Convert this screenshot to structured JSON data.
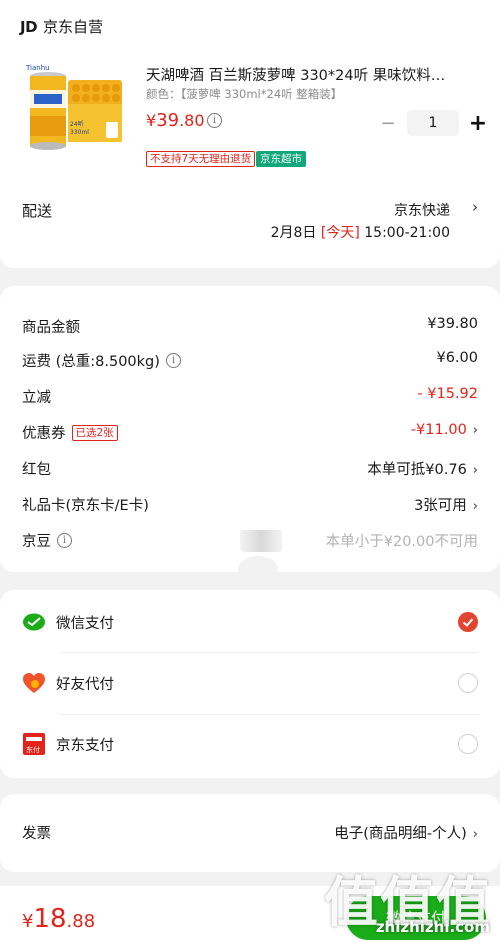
{
  "store": {
    "logo": "JD",
    "name": "京东自营"
  },
  "product": {
    "title": "天湖啤酒 百兰斯菠萝啤 330*24听 果味饮料…",
    "spec": "颜色：【菠萝啤 330ml*24听 整箱装】",
    "price_symbol": "¥",
    "price_int": "39",
    "price_dec": ".80",
    "quantity": "1",
    "tag_return": "不支持7天无理由退货",
    "tag_supermarket": "京东超市",
    "image_can_text": "24听 330ml"
  },
  "shipping": {
    "label": "配送",
    "method": "京东快递",
    "date": "2月8日",
    "today": "[今天]",
    "time": "15:00-21:00"
  },
  "summary": {
    "goods_label": "商品金额",
    "goods_value": "¥39.80",
    "freight_label": "运费 (总重:8.500kg)",
    "freight_value": "¥6.00",
    "discount_label": "立减",
    "discount_value": "- ¥15.92",
    "coupon_label": "优惠券",
    "coupon_tag": "已选2张",
    "coupon_value": "-¥11.00",
    "redpacket_label": "红包",
    "redpacket_value": "本单可抵¥0.76",
    "giftcard_label": "礼品卡(京东卡/E卡)",
    "giftcard_value": "3张可用",
    "jingdou_label": "京豆",
    "jingdou_prefix": "共",
    "jingdou_value": "本单小于¥20.00不可用"
  },
  "payment": {
    "options": [
      {
        "label": "微信支付",
        "selected": true
      },
      {
        "label": "好友代付",
        "selected": false
      },
      {
        "label": "京东支付",
        "selected": false
      }
    ],
    "jdpay_icon_text": "东付"
  },
  "invoice": {
    "label": "发票",
    "value": "电子(商品明细-个人)"
  },
  "footer": {
    "total_symbol": "¥",
    "total_int": "18",
    "total_dec": ".88",
    "pay_button": "微信支付"
  },
  "watermark": {
    "logo": "值值值",
    "url": "zhizhizhi.com"
  },
  "colors": {
    "accent_red": "#e2231a",
    "wechat_green": "#1aad19",
    "jd_green": "#12a77b"
  }
}
